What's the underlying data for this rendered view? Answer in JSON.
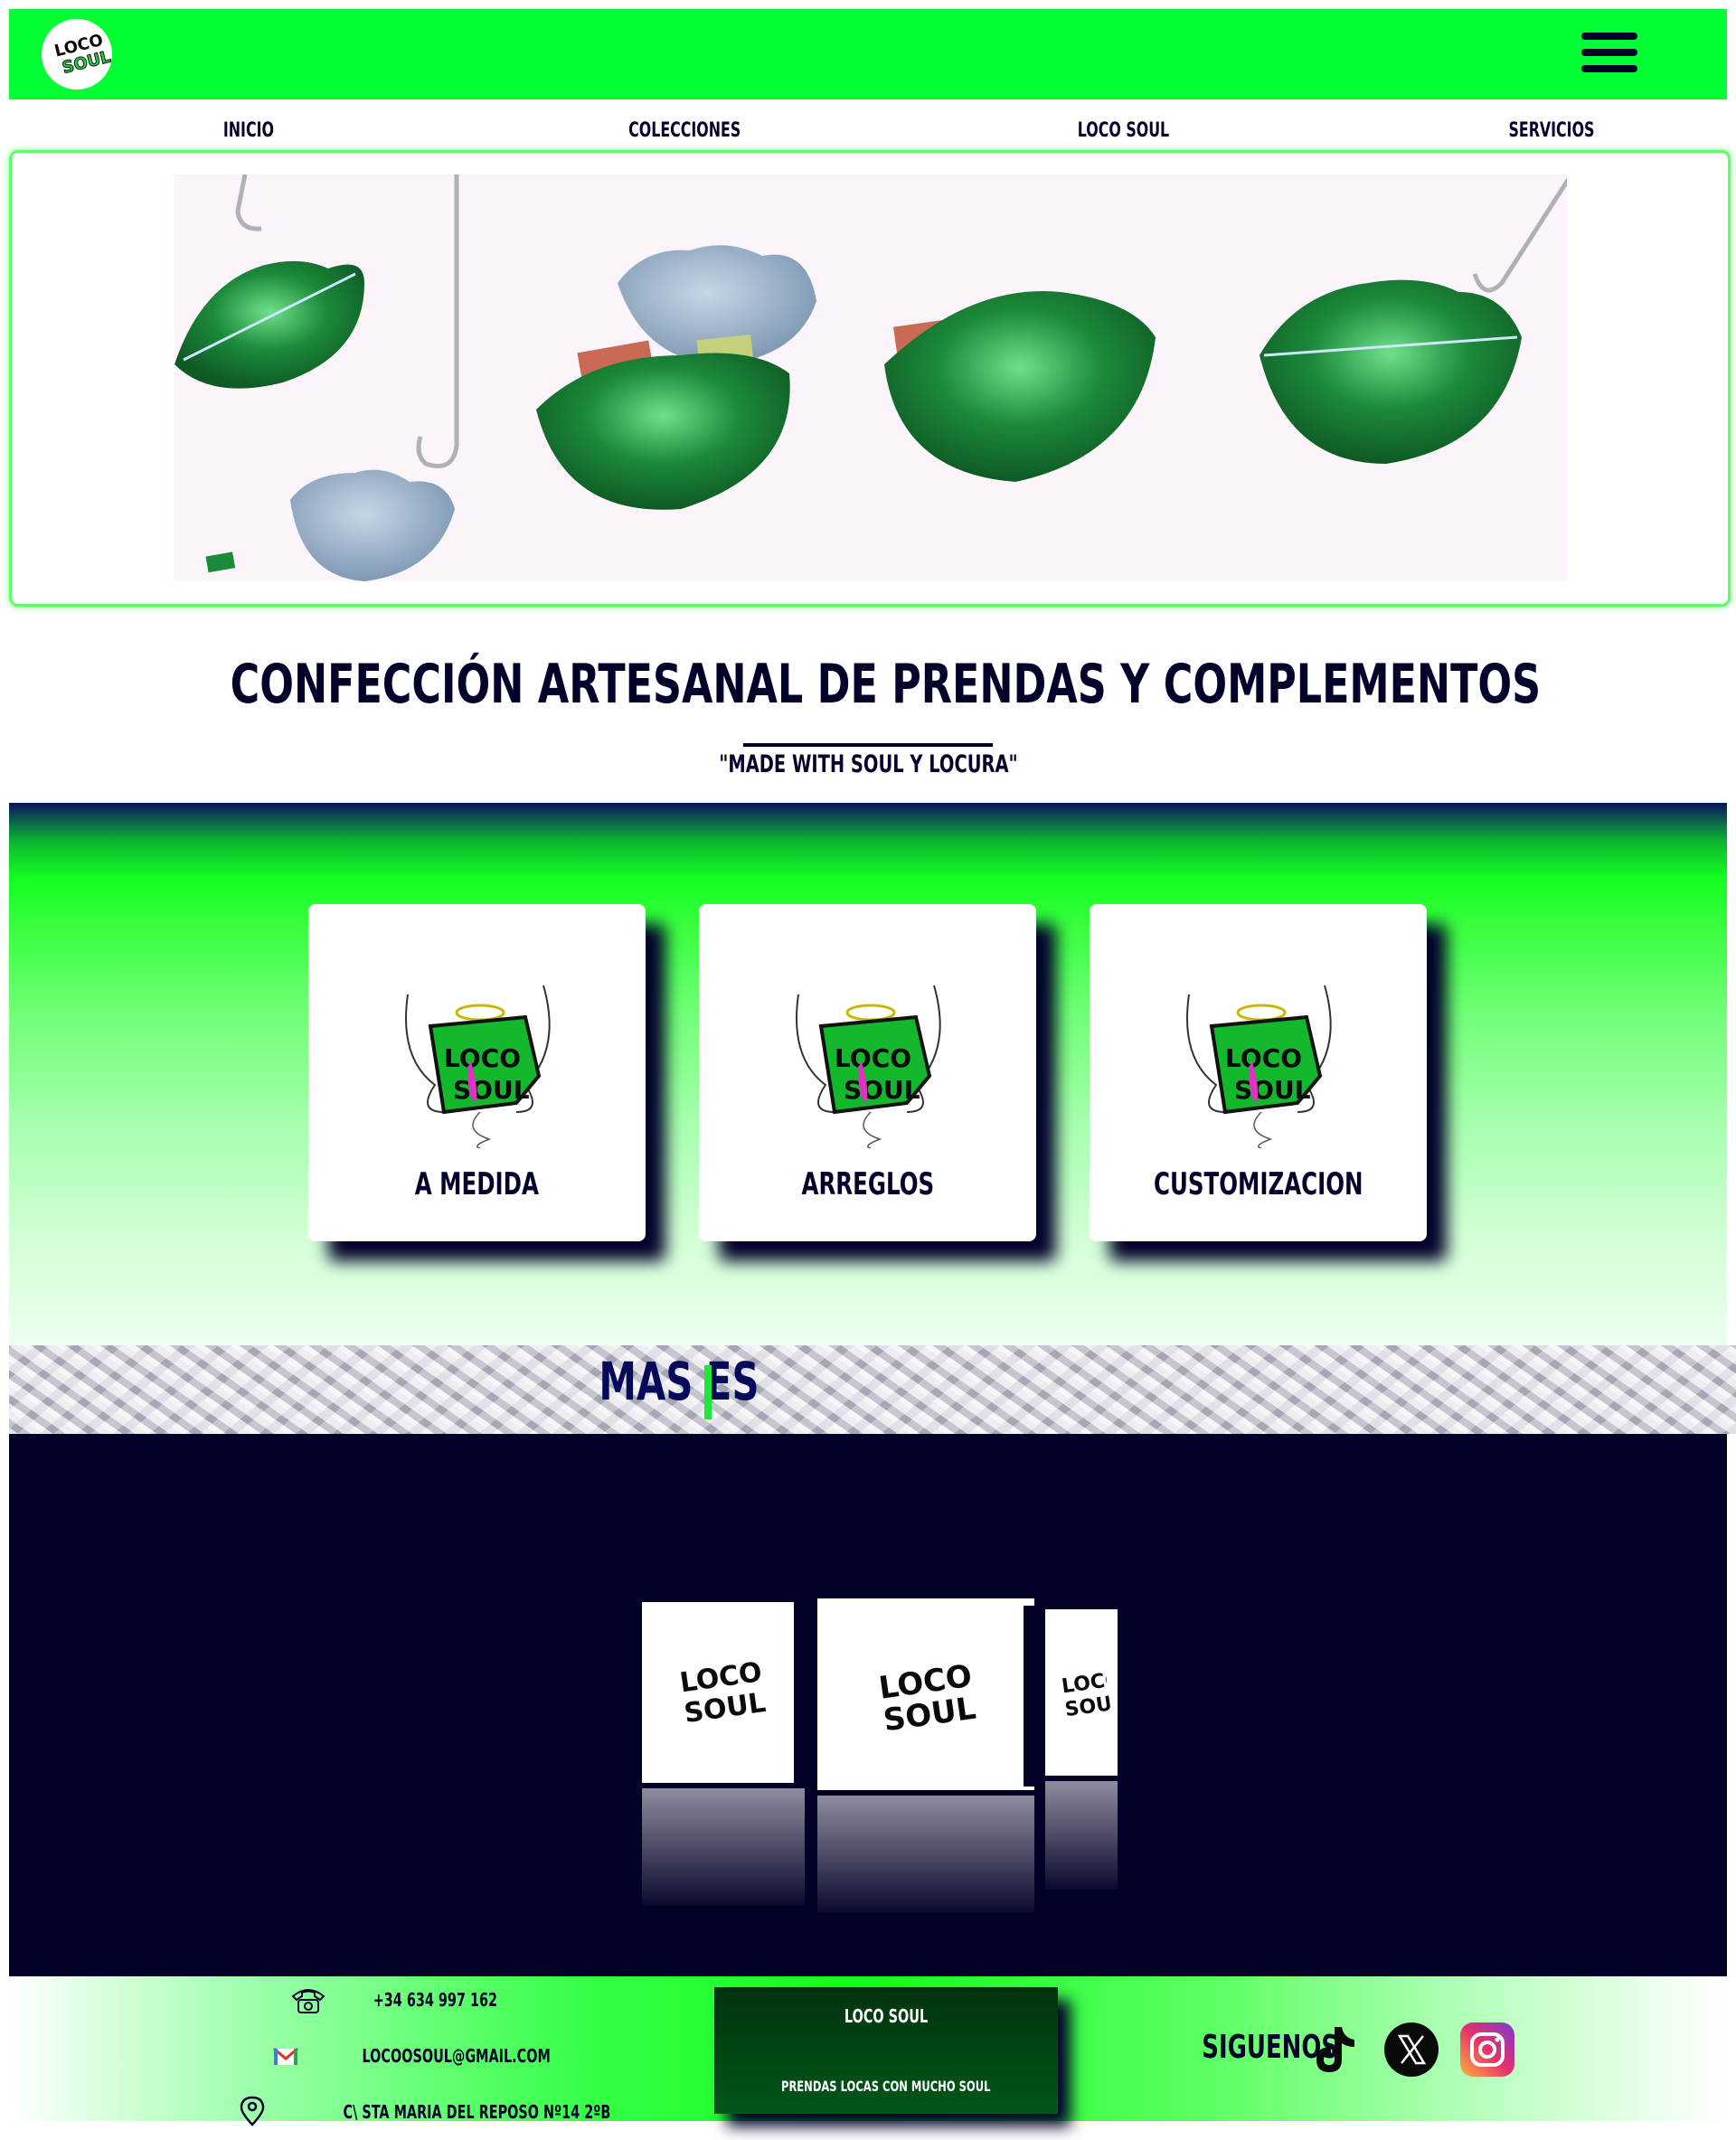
{
  "header": {
    "logo_text": "LOCO SOUL",
    "menu_icon": "hamburger-menu-icon"
  },
  "nav": {
    "items": [
      "INICIO",
      "COLECCIONES",
      "LOCO SOUL",
      "SERVICIOS"
    ]
  },
  "hero": {
    "image_subject": "lip-shaped-purses-on-hooks"
  },
  "intro": {
    "headline": "CONFECCIÓN ARTESANAL DE PRENDAS Y COMPLEMENTOS",
    "tagline": "\"MADE WITH SOUL Y LOCURA\""
  },
  "services": {
    "cards": [
      {
        "label": "A MEDIDA"
      },
      {
        "label": "ARREGLOS"
      },
      {
        "label": "CUSTOMIZACION"
      }
    ]
  },
  "banner": {
    "text": "MAS ES"
  },
  "carousel": {
    "panel_logo_text": "LOCO SOUL"
  },
  "footer": {
    "phone": "+34 634 997 162",
    "email": "LOCOOSOUL@GMAIL.COM",
    "address": "C\\ STA MARIA DEL REPOSO Nº14 2ºB",
    "brand_name": "LOCO SOUL",
    "brand_slogan": "PRENDAS LOCAS CON MUCHO SOUL",
    "follow_label": "SIGUENOS",
    "social_icons": [
      "tiktok-icon",
      "x-icon",
      "instagram-icon"
    ]
  },
  "colors": {
    "accent_green": "#00ff33",
    "navy": "#02022a",
    "white": "#ffffff"
  }
}
